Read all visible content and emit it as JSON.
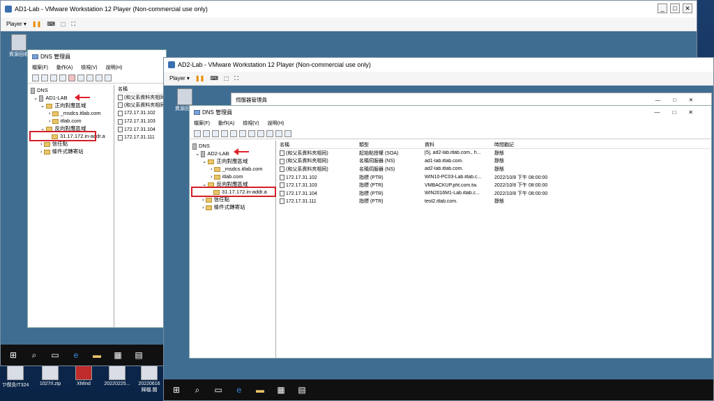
{
  "vm1": {
    "title": "AD1-Lab - VMware Workstation 12 Player (Non-commercial use only)",
    "player_label": "Player ▾"
  },
  "vm2": {
    "title": "AD2-Lab - VMware Workstation 12 Player (Non-commercial use only)",
    "player_label": "Player ▾"
  },
  "recycle_label": "資源回收",
  "server_manager_title": "伺服器管理員",
  "dns1": {
    "title": "DNS 管理員",
    "menu": [
      "檔案(F)",
      "動作(A)",
      "檢視(V)",
      "說明(H)"
    ],
    "tree": [
      "DNS",
      "AD1-LAB",
      "正向對應區域",
      "_msdcs.itlab.com",
      "itlab.com",
      "反向對應區域",
      "31.17.172.in-addr.a",
      "信任點",
      "條件式轉寄站"
    ],
    "col_name": "名稱",
    "rows": [
      "(和父系資料夾相同)",
      "(和父系資料夾相同)",
      "172.17.31.102",
      "172.17.31.103",
      "172.17.31.104",
      "172.17.31.111"
    ]
  },
  "dns2": {
    "title": "DNS 管理員",
    "menu": [
      "檔案(F)",
      "動作(A)",
      "檢視(V)",
      "說明(H)"
    ],
    "tree": [
      "DNS",
      "AD2-LAB",
      "正向對應區域",
      "_msdcs.itlab.com",
      "itlab.com",
      "反向對應區域",
      "31.17.172.in-addr.a",
      "信任點",
      "條件式轉寄站"
    ],
    "headers": [
      "名稱",
      "類型",
      "資料",
      "時間戳記"
    ],
    "rows": [
      [
        "(和父系資料夾相同)",
        "起始點授權 (SOA)",
        "[5], ad2-lab.itlab.com., h...",
        "靜態"
      ],
      [
        "(和父系資料夾相同)",
        "名稱伺服器 (NS)",
        "ad1-lab.itlab.com.",
        "靜態"
      ],
      [
        "(和父系資料夾相同)",
        "名稱伺服器 (NS)",
        "ad2-lab.itlab.com.",
        "靜態"
      ],
      [
        "172.17.31.102",
        "指標 (PTR)",
        "WIN10-PC03-Lab.itlab.c...",
        "2022/10/8 下午 08:00:00"
      ],
      [
        "172.17.31.103",
        "指標 (PTR)",
        "VMBACKUP.pht.com.tw.",
        "2022/10/8 下午 08:00:00"
      ],
      [
        "172.17.31.104",
        "指標 (PTR)",
        "WIN2016M1-Lab.itlab.c...",
        "2022/10/8 下午 08:00:00"
      ],
      [
        "172.17.31.111",
        "指標 (PTR)",
        "test2.itlab.com.",
        "靜態"
      ]
    ]
  },
  "host_desktop_icons": [
    "ㄗ偰灸IT324",
    "1027rl.zip",
    "XMind",
    "20220225...",
    "20220616\n歸檔.閱"
  ]
}
